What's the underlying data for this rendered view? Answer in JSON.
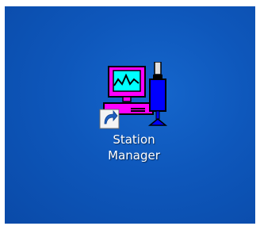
{
  "desktop": {
    "background_color": "#0e57bb",
    "shortcut": {
      "label": "Station\nManager",
      "icon": "station-manager-icon",
      "overlay_icon": "shortcut-arrow-icon",
      "colors": {
        "monitor": "#ff00ff",
        "screen": "#00ffff",
        "waveform": "#000000",
        "device": "#0000ff"
      }
    }
  }
}
